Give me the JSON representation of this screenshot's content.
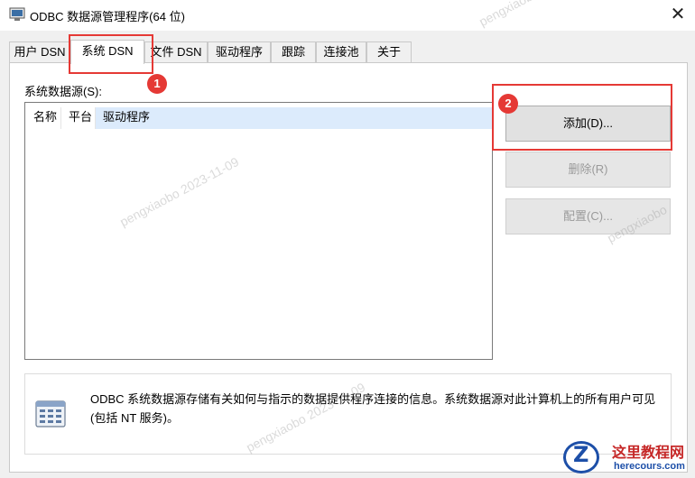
{
  "window": {
    "title": "ODBC 数据源管理程序(64 位)",
    "close_glyph": "✕"
  },
  "tabs": [
    {
      "label": "用户 DSN",
      "active": false
    },
    {
      "label": "系统 DSN",
      "active": true
    },
    {
      "label": "文件 DSN",
      "active": false
    },
    {
      "label": "驱动程序",
      "active": false
    },
    {
      "label": "跟踪",
      "active": false
    },
    {
      "label": "连接池",
      "active": false
    },
    {
      "label": "关于",
      "active": false
    }
  ],
  "datasources": {
    "label": "系统数据源(S):",
    "columns": [
      "名称",
      "平台",
      "驱动程序"
    ],
    "rows": []
  },
  "buttons": {
    "add": {
      "label": "添加(D)...",
      "enabled": true
    },
    "remove": {
      "label": "删除(R)",
      "enabled": false
    },
    "configure": {
      "label": "配置(C)...",
      "enabled": false
    }
  },
  "info": {
    "icon": "datasource-icon",
    "text": "ODBC 系统数据源存储有关如何与指示的数据提供程序连接的信息。系统数据源对此计算机上的所有用户可见(包括 NT 服务)。"
  },
  "annotations": [
    {
      "number": "1",
      "target": "系统 DSN tab"
    },
    {
      "number": "2",
      "target": "添加(D)... button"
    }
  ],
  "watermark": {
    "user": "pengxiaobo",
    "date": "2023-11-09"
  },
  "site_logo": {
    "title": "这里教程网",
    "subtitle": "herecours.com",
    "glyph": "Z"
  },
  "colors": {
    "annotation": "#e53935",
    "selection": "#dcebfc",
    "logo_blue": "#1d4fa8",
    "logo_red": "#c62828"
  }
}
